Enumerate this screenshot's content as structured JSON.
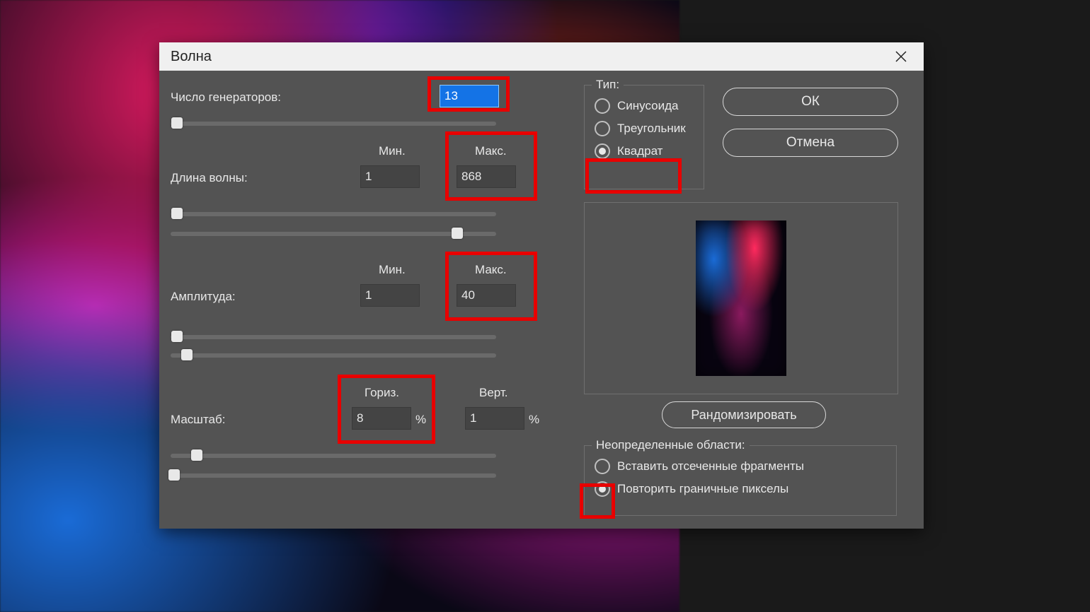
{
  "dialog": {
    "title": "Волна",
    "generators": {
      "label": "Число генераторов:",
      "value": "13"
    },
    "wavelength": {
      "label": "Длина волны:",
      "minLabel": "Мин.",
      "maxLabel": "Макс.",
      "min": "1",
      "max": "868"
    },
    "amplitude": {
      "label": "Амплитуда:",
      "minLabel": "Мин.",
      "maxLabel": "Макс.",
      "min": "1",
      "max": "40"
    },
    "scale": {
      "label": "Масштаб:",
      "horizLabel": "Гориз.",
      "vertLabel": "Верт.",
      "horiz": "8",
      "vert": "1",
      "unit": "%"
    },
    "type": {
      "legend": "Тип:",
      "options": {
        "sine": "Синусоида",
        "triangle": "Треугольник",
        "square": "Квадрат"
      },
      "selected": "square"
    },
    "undefinedAreas": {
      "legend": "Неопределенные области:",
      "options": {
        "wrap": "Вставить отсеченные фрагменты",
        "repeat": "Повторить граничные пикселы"
      },
      "selected": "repeat"
    },
    "buttons": {
      "ok": "ОК",
      "cancel": "Отмена",
      "randomize": "Рандомизировать"
    }
  }
}
